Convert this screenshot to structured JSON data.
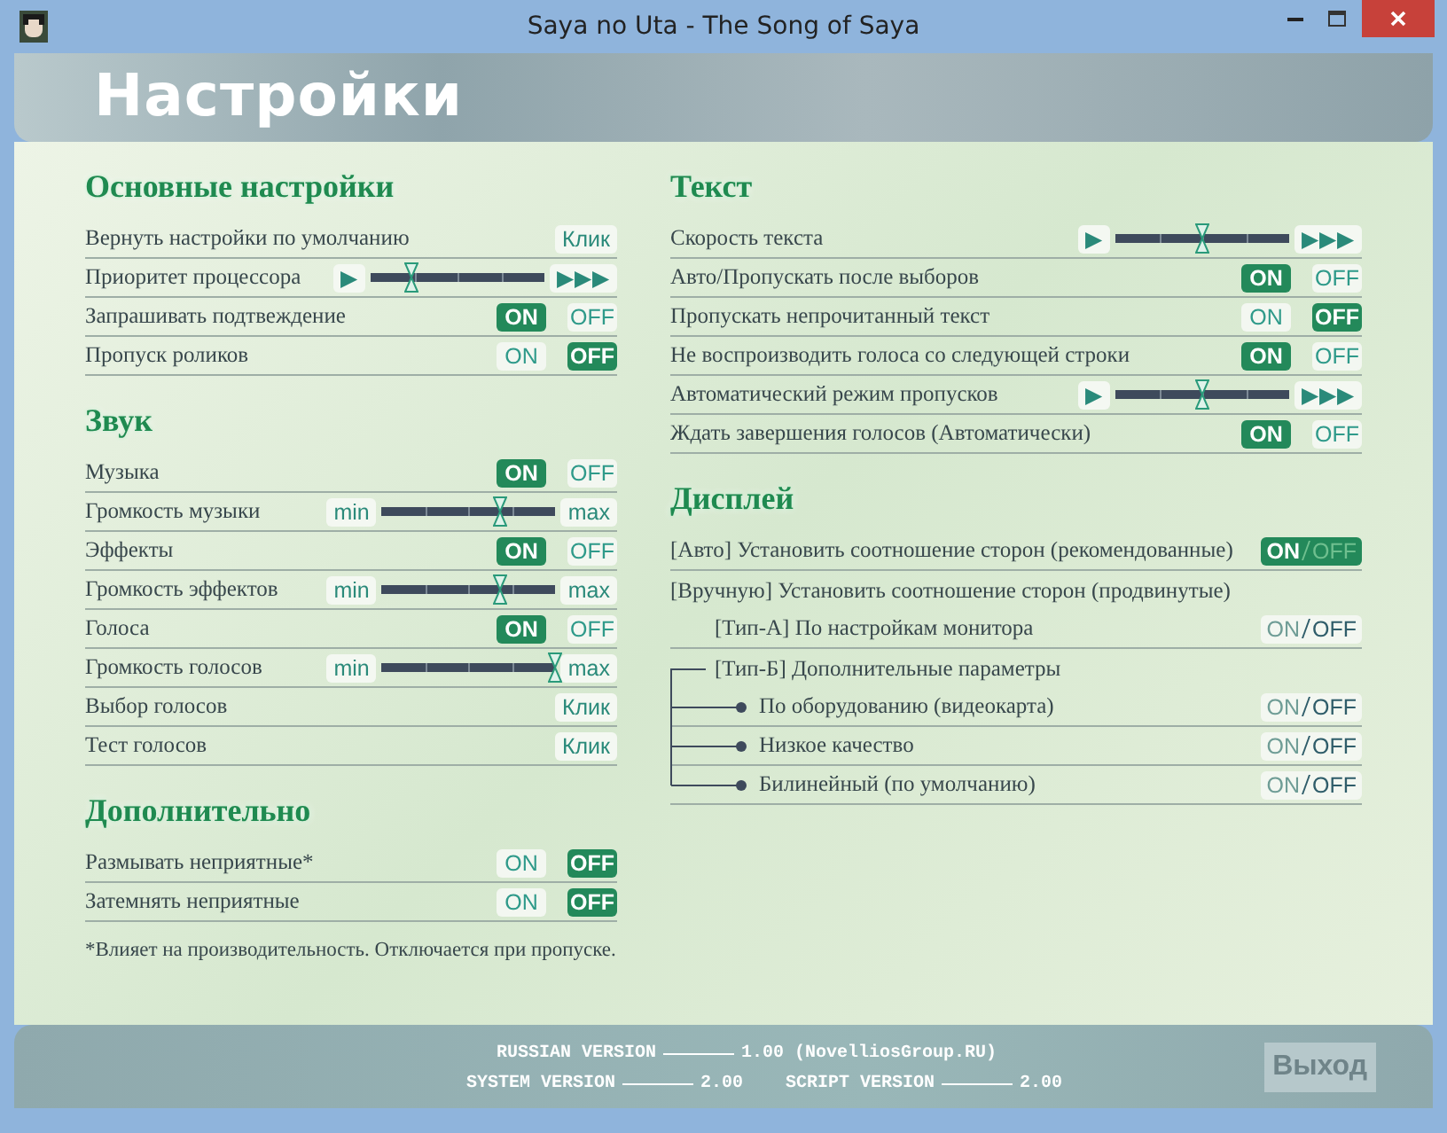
{
  "window": {
    "title": "Saya no Uta - The Song of Saya"
  },
  "header": {
    "title": "Настройки"
  },
  "left_sections": [
    {
      "title": "Основные настройки",
      "rows": [
        {
          "kind": "button",
          "label": "Вернуть настройки по умолчанию",
          "button": "Клик"
        },
        {
          "kind": "slider",
          "label": "Приоритет процессора",
          "start": "▶",
          "end": "▶▶▶",
          "level": 0.23
        },
        {
          "kind": "toggle",
          "label": "Запрашивать подтвеждение",
          "on_label": "ON",
          "off_label": "OFF",
          "on": true
        },
        {
          "kind": "toggle",
          "label": "Пропуск роликов",
          "on_label": "ON",
          "off_label": "OFF",
          "on": false
        }
      ]
    },
    {
      "title": "Звук",
      "rows": [
        {
          "kind": "toggle",
          "label": "Музыка",
          "on_label": "ON",
          "off_label": "OFF",
          "on": true
        },
        {
          "kind": "slider",
          "label": "Громкость музыки",
          "start": "min",
          "end": "max",
          "level": 0.68
        },
        {
          "kind": "toggle",
          "label": "Эффекты",
          "on_label": "ON",
          "off_label": "OFF",
          "on": true
        },
        {
          "kind": "slider",
          "label": "Громкость эффектов",
          "start": "min",
          "end": "max",
          "level": 0.68
        },
        {
          "kind": "toggle",
          "label": "Голоса",
          "on_label": "ON",
          "off_label": "OFF",
          "on": true
        },
        {
          "kind": "slider",
          "label": "Громкость голосов",
          "start": "min",
          "end": "max",
          "level": 1.0
        },
        {
          "kind": "button",
          "label": "Выбор голосов",
          "button": "Клик"
        },
        {
          "kind": "button",
          "label": "Тест голосов",
          "button": "Клик"
        }
      ]
    },
    {
      "title": "Дополнительно",
      "rows": [
        {
          "kind": "toggle",
          "label": "Размывать неприятные*",
          "on_label": "ON",
          "off_label": "OFF",
          "on": false
        },
        {
          "kind": "toggle",
          "label": "Затемнять неприятные",
          "on_label": "ON",
          "off_label": "OFF",
          "on": false
        }
      ],
      "note": "*Влияет на производительность. Отключается при пропуске."
    }
  ],
  "right_sections": [
    {
      "title": "Текст",
      "rows": [
        {
          "kind": "slider",
          "label": "Скорость текста",
          "start": "▶",
          "end": "▶▶▶",
          "level": 0.5
        },
        {
          "kind": "toggle",
          "label": "Авто/Пропускать после выборов",
          "on_label": "ON",
          "off_label": "OFF",
          "on": true
        },
        {
          "kind": "toggle",
          "label": "Пропускать непрочитанный текст",
          "on_label": "ON",
          "off_label": "OFF",
          "on": false
        },
        {
          "kind": "toggle",
          "label": "Не воспроизводить голоса со следующей строки",
          "on_label": "ON",
          "off_label": "OFF",
          "on": true
        },
        {
          "kind": "slider",
          "label": "Автоматический режим пропусков",
          "start": "▶",
          "end": "▶▶▶",
          "level": 0.5
        },
        {
          "kind": "toggle",
          "label": "Ждать завершения голосов (Автоматически)",
          "on_label": "ON",
          "off_label": "OFF",
          "on": true
        }
      ]
    },
    {
      "title": "Дисплей",
      "rows": [
        {
          "kind": "onoff",
          "label": "[Авто] Установить соотношение сторон (рекомендованные)",
          "on_label": "ON",
          "off_label": "OFF",
          "on": true
        },
        {
          "kind": "label",
          "label": "[Вручную] Установить соотношение сторон (продвинутые)",
          "children": [
            {
              "kind": "onoff",
              "label": "[Тип-А] По настройкам монитора",
              "on_label": "ON",
              "off_label": "OFF",
              "on": false
            },
            {
              "kind": "label",
              "label": "[Тип-Б] Дополнительные параметры",
              "children": [
                {
                  "kind": "onoff",
                  "label": "По оборудованию (видеокарта)",
                  "on_label": "ON",
                  "off_label": "OFF",
                  "on": false
                },
                {
                  "kind": "onoff",
                  "label": "Низкое качество",
                  "on_label": "ON",
                  "off_label": "OFF",
                  "on": false
                },
                {
                  "kind": "onoff",
                  "label": "Билинейный (по умолчанию)",
                  "on_label": "ON",
                  "off_label": "OFF",
                  "on": false
                }
              ]
            }
          ]
        }
      ]
    }
  ],
  "footer": {
    "russian_label": "RUSSIAN VERSION",
    "russian_value": "1.00 (NovelliosGroup.RU)",
    "system_label": "SYSTEM VERSION",
    "system_value": "2.00",
    "script_label": "SCRIPT VERSION",
    "script_value": "2.00",
    "exit_button": "Выход"
  }
}
